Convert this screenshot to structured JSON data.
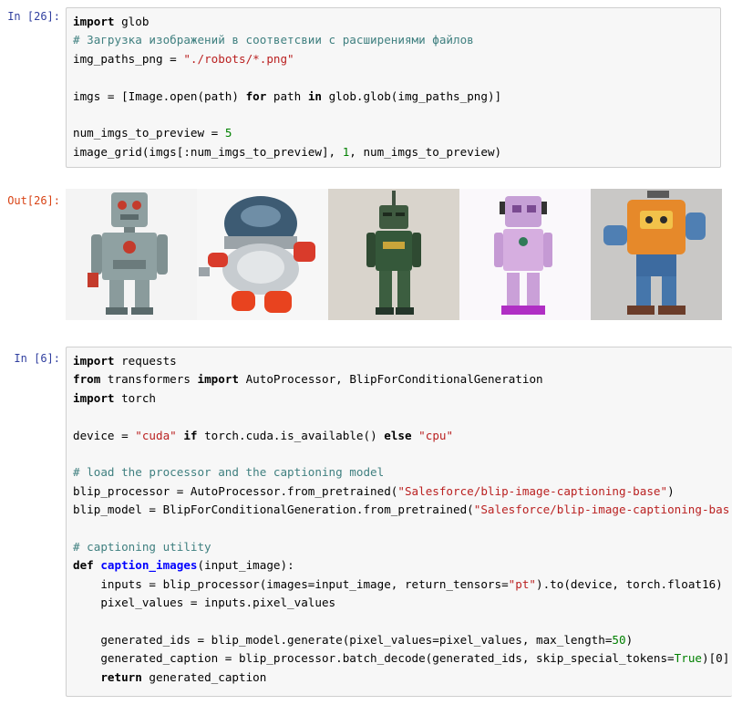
{
  "cells": {
    "c1": {
      "prompt": "In [26]:"
    },
    "c1_out": {
      "prompt": "Out[26]:"
    },
    "c2": {
      "prompt": "In [6]:"
    }
  },
  "code1": [
    [
      {
        "t": "kw",
        "v": "import"
      },
      {
        "t": "p",
        "v": " glob"
      }
    ],
    [
      {
        "t": "cm",
        "v": "# Загрузка изображений в соответсвии с расширениями файлов"
      }
    ],
    [
      {
        "t": "p",
        "v": "img_paths_png = "
      },
      {
        "t": "str",
        "v": "\"./robots/*.png\""
      }
    ],
    [],
    [
      {
        "t": "p",
        "v": "imgs = [Image.open(path) "
      },
      {
        "t": "kw",
        "v": "for"
      },
      {
        "t": "p",
        "v": " path "
      },
      {
        "t": "kw",
        "v": "in"
      },
      {
        "t": "p",
        "v": " glob.glob(img_paths_png)]"
      }
    ],
    [],
    [
      {
        "t": "p",
        "v": "num_imgs_to_preview = "
      },
      {
        "t": "num",
        "v": "5"
      }
    ],
    [
      {
        "t": "p",
        "v": "image_grid(imgs[:num_imgs_to_preview], "
      },
      {
        "t": "num",
        "v": "1"
      },
      {
        "t": "p",
        "v": ", num_imgs_to_preview)"
      }
    ]
  ],
  "code2": [
    [
      {
        "t": "kw",
        "v": "import"
      },
      {
        "t": "p",
        "v": " requests"
      }
    ],
    [
      {
        "t": "kw",
        "v": "from"
      },
      {
        "t": "p",
        "v": " transformers "
      },
      {
        "t": "kw",
        "v": "import"
      },
      {
        "t": "p",
        "v": " AutoProcessor, BlipForConditionalGeneration"
      }
    ],
    [
      {
        "t": "kw",
        "v": "import"
      },
      {
        "t": "p",
        "v": " torch"
      }
    ],
    [],
    [
      {
        "t": "p",
        "v": "device = "
      },
      {
        "t": "str",
        "v": "\"cuda\""
      },
      {
        "t": "p",
        "v": " "
      },
      {
        "t": "kw",
        "v": "if"
      },
      {
        "t": "p",
        "v": " torch.cuda.is_available() "
      },
      {
        "t": "kw",
        "v": "else"
      },
      {
        "t": "p",
        "v": " "
      },
      {
        "t": "str",
        "v": "\"cpu\""
      }
    ],
    [],
    [
      {
        "t": "cm",
        "v": "# load the processor and the captioning model"
      }
    ],
    [
      {
        "t": "p",
        "v": "blip_processor = AutoProcessor.from_pretrained("
      },
      {
        "t": "str",
        "v": "\"Salesforce/blip-image-captioning-base\""
      },
      {
        "t": "p",
        "v": ")"
      }
    ],
    [
      {
        "t": "p",
        "v": "blip_model = BlipForConditionalGeneration.from_pretrained("
      },
      {
        "t": "str",
        "v": "\"Salesforce/blip-image-captioning-bas"
      }
    ],
    [],
    [
      {
        "t": "cm",
        "v": "# captioning utility"
      }
    ],
    [
      {
        "t": "kw",
        "v": "def"
      },
      {
        "t": "p",
        "v": " "
      },
      {
        "t": "fn",
        "v": "caption_images"
      },
      {
        "t": "p",
        "v": "(input_image):"
      }
    ],
    [
      {
        "t": "p",
        "v": "    inputs = blip_processor(images=input_image, return_tensors="
      },
      {
        "t": "str",
        "v": "\"pt\""
      },
      {
        "t": "p",
        "v": ").to(device, torch.float16)"
      }
    ],
    [
      {
        "t": "p",
        "v": "    pixel_values = inputs.pixel_values"
      }
    ],
    [],
    [
      {
        "t": "p",
        "v": "    generated_ids = blip_model.generate(pixel_values=pixel_values, max_length="
      },
      {
        "t": "num",
        "v": "50"
      },
      {
        "t": "p",
        "v": ")"
      }
    ],
    [
      {
        "t": "p",
        "v": "    generated_caption = blip_processor.batch_decode(generated_ids, skip_special_tokens="
      },
      {
        "t": "bi",
        "v": "True"
      },
      {
        "t": "p",
        "v": ")[0]"
      }
    ],
    [
      {
        "t": "p",
        "v": "    "
      },
      {
        "t": "kw",
        "v": "return"
      },
      {
        "t": "p",
        "v": " generated_caption"
      }
    ]
  ],
  "colors": {
    "prompt_in": "#303f9f",
    "prompt_out": "#d84315",
    "keyword": "#000000",
    "string": "#ba2121",
    "number": "#008000",
    "comment": "#408080",
    "function": "#0000ff"
  },
  "images": [
    {
      "name": "gray-tin-robot-image"
    },
    {
      "name": "silver-dome-robot-image"
    },
    {
      "name": "green-robot-image"
    },
    {
      "name": "pink-robot-image"
    },
    {
      "name": "orange-robot-image"
    }
  ]
}
